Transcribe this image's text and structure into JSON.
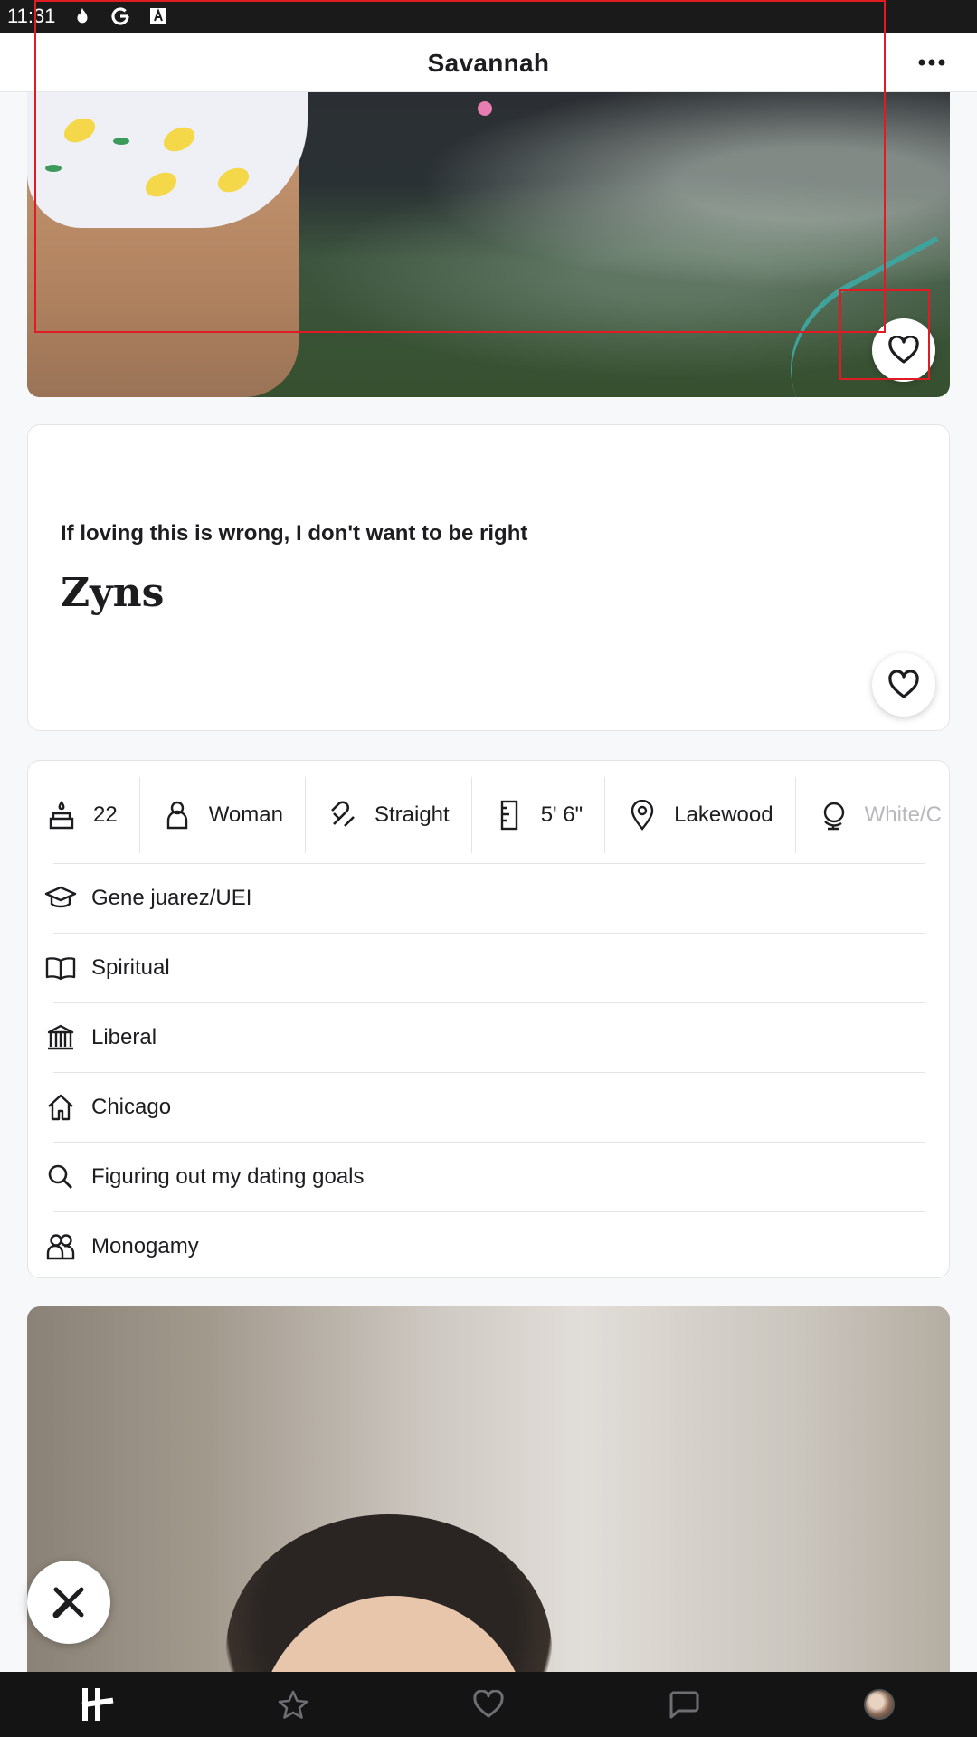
{
  "status_bar": {
    "time": "11:31",
    "icons": [
      "tinder-flame-icon",
      "google-icon",
      "font-a-icon"
    ]
  },
  "header": {
    "title": "Savannah",
    "more_icon": "more-horizontal-icon"
  },
  "photo_top": {
    "like_icon": "heart-icon"
  },
  "prompt": {
    "question": "If loving this is wrong, I don't want to be right",
    "answer": "Zyns",
    "like_icon": "heart-icon"
  },
  "info": {
    "chips": [
      {
        "icon": "cake-icon",
        "label": "22"
      },
      {
        "icon": "person-icon",
        "label": "Woman"
      },
      {
        "icon": "magnet-icon",
        "label": "Straight"
      },
      {
        "icon": "ruler-icon",
        "label": "5' 6\""
      },
      {
        "icon": "location-pin-icon",
        "label": "Lakewood"
      },
      {
        "icon": "globe-icon",
        "label": "White/C"
      }
    ],
    "rows": [
      {
        "icon": "graduation-cap-icon",
        "label": "Gene juarez/UEI"
      },
      {
        "icon": "book-icon",
        "label": "Spiritual"
      },
      {
        "icon": "institution-icon",
        "label": "Liberal"
      },
      {
        "icon": "home-icon",
        "label": "Chicago"
      },
      {
        "icon": "search-icon",
        "label": "Figuring out my dating goals"
      },
      {
        "icon": "people-icon",
        "label": "Monogamy"
      }
    ]
  },
  "close_icon": "close-x-icon",
  "bottom_nav": {
    "items": [
      {
        "name": "discover",
        "icon": "hinge-logo-icon"
      },
      {
        "name": "standouts",
        "icon": "star-icon"
      },
      {
        "name": "likes",
        "icon": "heart-icon"
      },
      {
        "name": "matches",
        "icon": "chat-icon"
      },
      {
        "name": "profile",
        "icon": "avatar"
      }
    ]
  },
  "colors": {
    "annotation": "#e01b24",
    "nav_bg": "#141414",
    "card_border": "#e3e4e6"
  }
}
